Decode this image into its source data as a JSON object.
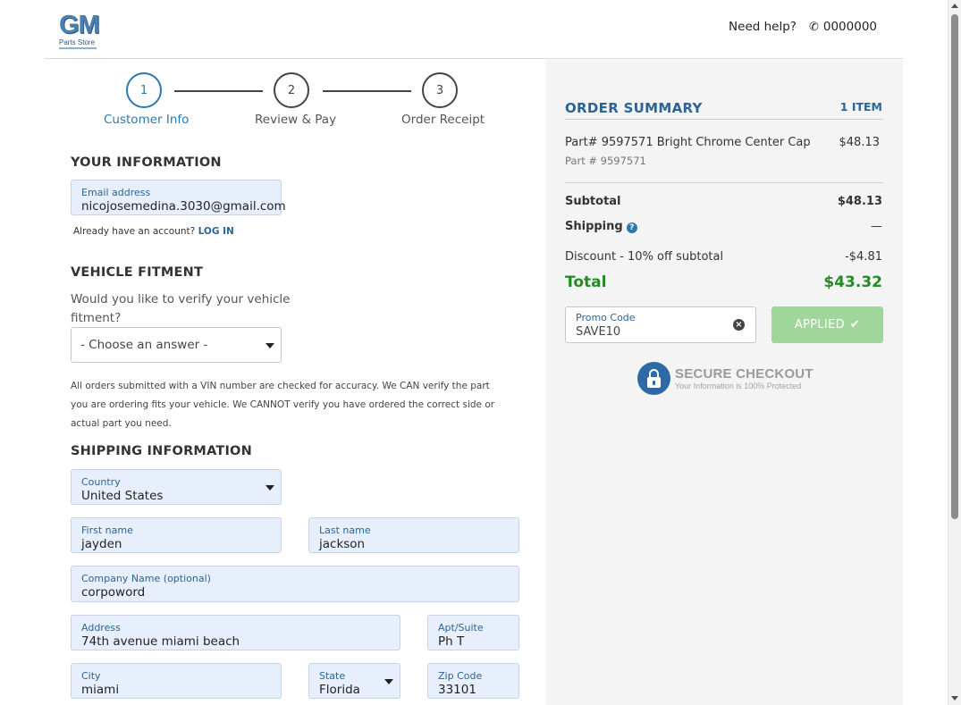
{
  "header": {
    "logo_text": "GM",
    "logo_sub": "Parts Store",
    "help_text": "Need help?",
    "phone": "0000000"
  },
  "stepper": {
    "steps": [
      {
        "number": "1",
        "label": "Customer Info",
        "active": true
      },
      {
        "number": "2",
        "label": "Review & Pay",
        "active": false
      },
      {
        "number": "3",
        "label": "Order Receipt",
        "active": false
      }
    ]
  },
  "your_info": {
    "title": "YOUR INFORMATION",
    "email_label": "Email address",
    "email_value": "nicojosemedina.3030@gmail.com",
    "account_prompt": "Already have an account?",
    "login_link": "LOG IN"
  },
  "fitment": {
    "title": "VEHICLE FITMENT",
    "question": "Would you like to verify your vehicle fitment?",
    "select_value": "- Choose an answer -",
    "note": "All orders submitted with a VIN number are checked for accuracy. We CAN verify the part you are ordering fits your vehicle. We CANNOT verify you have ordered the correct side or actual part you need."
  },
  "shipping": {
    "title": "SHIPPING INFORMATION",
    "country": {
      "label": "Country",
      "value": "United States"
    },
    "first_name": {
      "label": "First name",
      "value": "jayden"
    },
    "last_name": {
      "label": "Last name",
      "value": "jackson"
    },
    "company": {
      "label": "Company Name (optional)",
      "value": "corpoword"
    },
    "address": {
      "label": "Address",
      "value": "74th avenue miami beach"
    },
    "apt": {
      "label": "Apt/Suite",
      "value": "Ph T"
    },
    "city": {
      "label": "City",
      "value": "miami"
    },
    "state": {
      "label": "State",
      "value": "Florida"
    },
    "zip": {
      "label": "Zip Code",
      "value": "33101"
    }
  },
  "summary": {
    "title": "ORDER SUMMARY",
    "item_count": "1 ITEM",
    "item_name": "Part# 9597571 Bright Chrome Center Cap",
    "item_part": "Part # 9597571",
    "item_price": "$48.13",
    "subtotal_label": "Subtotal",
    "subtotal_value": "$48.13",
    "shipping_label": "Shipping",
    "shipping_value": "—",
    "discount_label": "Discount - 10% off subtotal",
    "discount_value": "-$4.81",
    "total_label": "Total",
    "total_value": "$43.32",
    "promo_label": "Promo Code",
    "promo_value": "SAVE10",
    "applied_label": "APPLIED",
    "secure_title": "SECURE CHECKOUT",
    "secure_sub": "Your Information is 100% Protected"
  },
  "colors": {
    "accent": "#2a7ab0",
    "total_green": "#238c23",
    "applied_button": "#9ed69b",
    "field_bg": "#e8effc",
    "summary_bg": "#f4f4f4"
  }
}
